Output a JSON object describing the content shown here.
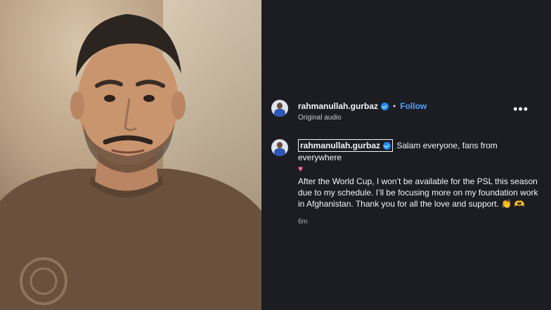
{
  "post": {
    "username": "rahmanullah.gurbaz",
    "separator": "•",
    "follow_label": "Follow",
    "audio_label": "Original audio",
    "more_label": "•••"
  },
  "caption": {
    "username": "rahmanullah.gurbaz",
    "line1": "Salam everyone, fans from everywhere",
    "heart": "♥",
    "body": "After the World Cup, I won’t be available for the PSL this season due to my schedule. I’ll be focusing more on my foundation work in Afghanistan. Thank you for all the love and support. 👏 🫶",
    "time": "6m"
  },
  "colors": {
    "panel_bg": "#1c1d22",
    "accent": "#4aa3ff",
    "verified": "#1d8cf8"
  }
}
